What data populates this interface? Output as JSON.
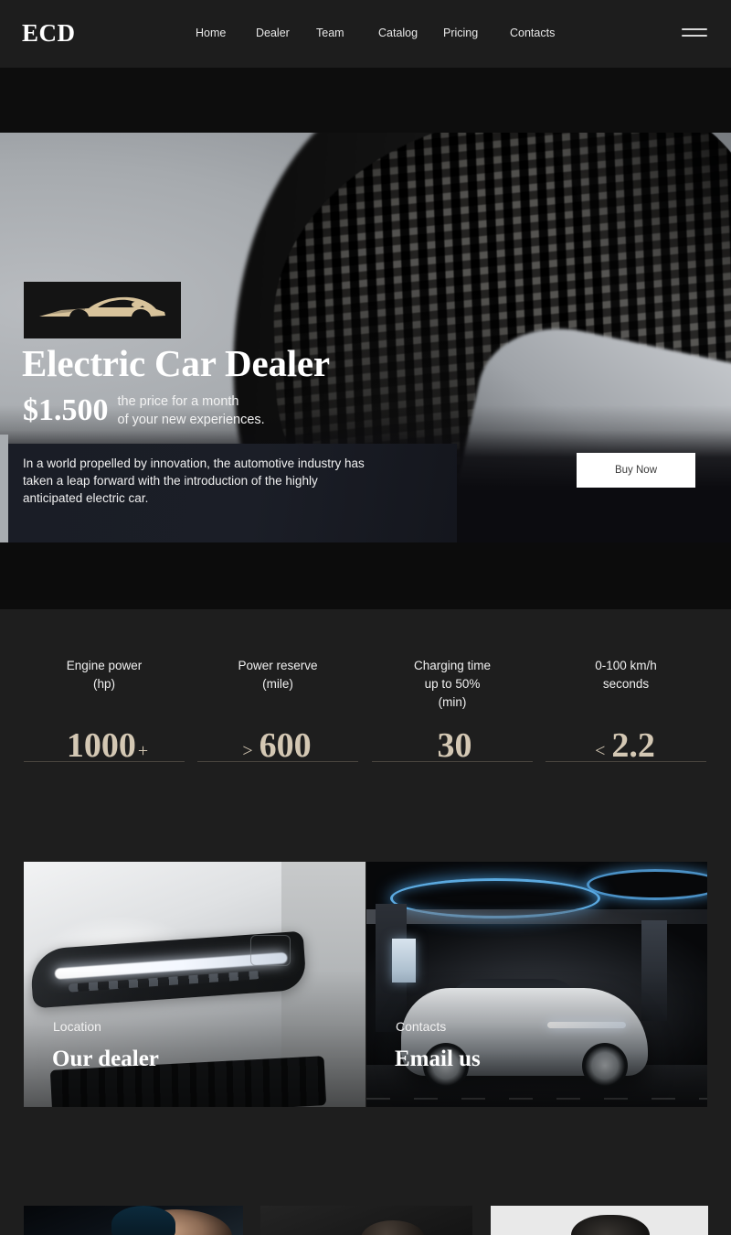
{
  "navbar": {
    "brand": "ECD",
    "links": [
      {
        "label": "Home"
      },
      {
        "label": "Dealer"
      },
      {
        "label": "Team"
      },
      {
        "label": "Catalog"
      },
      {
        "label": "Pricing"
      },
      {
        "label": "Contacts"
      }
    ],
    "menu_icon": "hamburger-icon"
  },
  "hero": {
    "badge_icon": "car-silhouette-icon",
    "title": "Electric Car Dealer",
    "price": "$1.500",
    "price_sub_line1": "the price for a month",
    "price_sub_line2": "of your new experiences.",
    "description": "In a world propelled by innovation, the automotive industry has taken a leap forward with the introduction of the highly anticipated electric car.",
    "buy_button": "Buy Now"
  },
  "stats": [
    {
      "label": "Engine power\n(hp)",
      "prefix": "",
      "value": "1000",
      "suffix": "+"
    },
    {
      "label": "Power reserve\n(mile)",
      "prefix": ">",
      "value": "600",
      "suffix": ""
    },
    {
      "label": "Charging time\nup to 50%\n(min)",
      "prefix": "",
      "value": "30",
      "suffix": ""
    },
    {
      "label": "0-100 km/h\nseconds",
      "prefix": "<",
      "value": "2.2",
      "suffix": ""
    }
  ],
  "cards": [
    {
      "kicker": "Location",
      "title": "Our dealer",
      "image": "car-headlight-photo"
    },
    {
      "kicker": "Contacts",
      "title": "Email us",
      "image": "electric-car-charging-station-photo"
    }
  ],
  "team": [
    {
      "image": "team-member-photo-1"
    },
    {
      "image": "team-member-photo-2"
    },
    {
      "image": "team-member-photo-3"
    }
  ],
  "colors": {
    "page_background": "#1c1c1c",
    "navbar_background": "#1d1d1d",
    "stats_background": "#1e1e1e",
    "accent_gold": "#d4c8b4",
    "text_primary": "#ffffff",
    "button_background": "#ffffff",
    "button_text": "#3a3a3a",
    "hero_overlay": "#1a1d26"
  }
}
